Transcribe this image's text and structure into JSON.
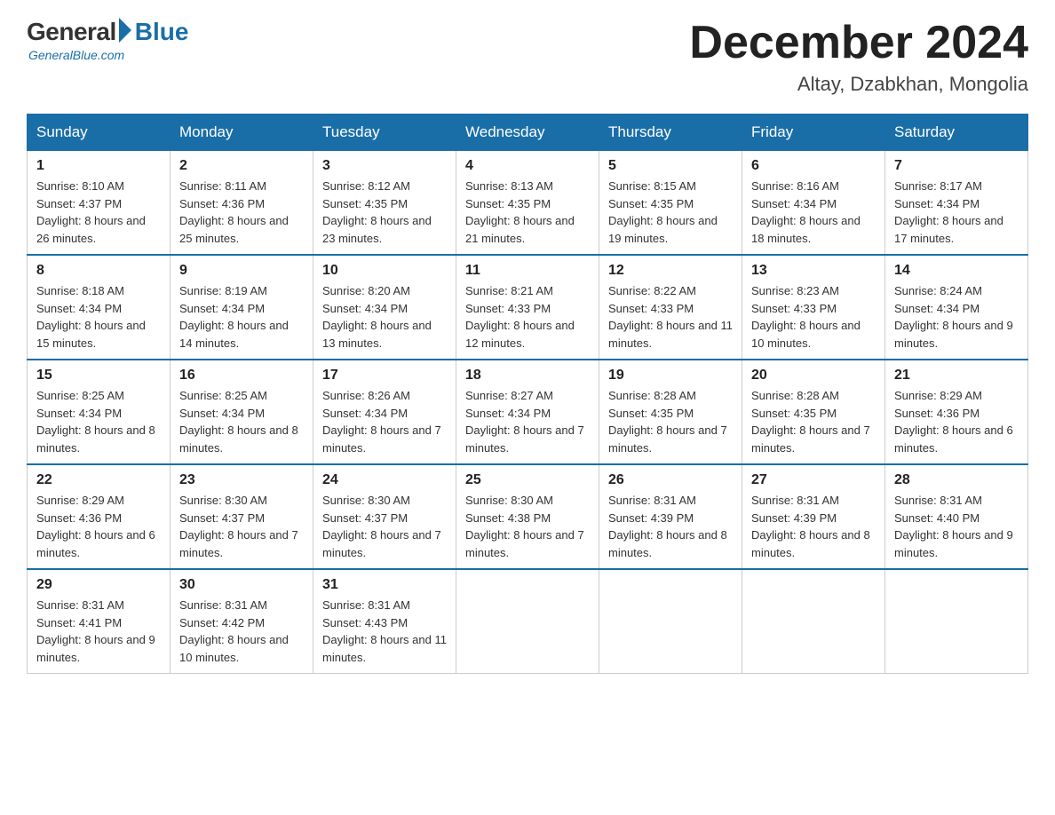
{
  "header": {
    "logo_general": "General",
    "logo_blue": "Blue",
    "logo_tagline": "GeneralBlue.com",
    "month": "December 2024",
    "location": "Altay, Dzabkhan, Mongolia"
  },
  "weekdays": [
    "Sunday",
    "Monday",
    "Tuesday",
    "Wednesday",
    "Thursday",
    "Friday",
    "Saturday"
  ],
  "weeks": [
    [
      {
        "day": "1",
        "sunrise": "8:10 AM",
        "sunset": "4:37 PM",
        "daylight": "8 hours and 26 minutes."
      },
      {
        "day": "2",
        "sunrise": "8:11 AM",
        "sunset": "4:36 PM",
        "daylight": "8 hours and 25 minutes."
      },
      {
        "day": "3",
        "sunrise": "8:12 AM",
        "sunset": "4:35 PM",
        "daylight": "8 hours and 23 minutes."
      },
      {
        "day": "4",
        "sunrise": "8:13 AM",
        "sunset": "4:35 PM",
        "daylight": "8 hours and 21 minutes."
      },
      {
        "day": "5",
        "sunrise": "8:15 AM",
        "sunset": "4:35 PM",
        "daylight": "8 hours and 19 minutes."
      },
      {
        "day": "6",
        "sunrise": "8:16 AM",
        "sunset": "4:34 PM",
        "daylight": "8 hours and 18 minutes."
      },
      {
        "day": "7",
        "sunrise": "8:17 AM",
        "sunset": "4:34 PM",
        "daylight": "8 hours and 17 minutes."
      }
    ],
    [
      {
        "day": "8",
        "sunrise": "8:18 AM",
        "sunset": "4:34 PM",
        "daylight": "8 hours and 15 minutes."
      },
      {
        "day": "9",
        "sunrise": "8:19 AM",
        "sunset": "4:34 PM",
        "daylight": "8 hours and 14 minutes."
      },
      {
        "day": "10",
        "sunrise": "8:20 AM",
        "sunset": "4:34 PM",
        "daylight": "8 hours and 13 minutes."
      },
      {
        "day": "11",
        "sunrise": "8:21 AM",
        "sunset": "4:33 PM",
        "daylight": "8 hours and 12 minutes."
      },
      {
        "day": "12",
        "sunrise": "8:22 AM",
        "sunset": "4:33 PM",
        "daylight": "8 hours and 11 minutes."
      },
      {
        "day": "13",
        "sunrise": "8:23 AM",
        "sunset": "4:33 PM",
        "daylight": "8 hours and 10 minutes."
      },
      {
        "day": "14",
        "sunrise": "8:24 AM",
        "sunset": "4:34 PM",
        "daylight": "8 hours and 9 minutes."
      }
    ],
    [
      {
        "day": "15",
        "sunrise": "8:25 AM",
        "sunset": "4:34 PM",
        "daylight": "8 hours and 8 minutes."
      },
      {
        "day": "16",
        "sunrise": "8:25 AM",
        "sunset": "4:34 PM",
        "daylight": "8 hours and 8 minutes."
      },
      {
        "day": "17",
        "sunrise": "8:26 AM",
        "sunset": "4:34 PM",
        "daylight": "8 hours and 7 minutes."
      },
      {
        "day": "18",
        "sunrise": "8:27 AM",
        "sunset": "4:34 PM",
        "daylight": "8 hours and 7 minutes."
      },
      {
        "day": "19",
        "sunrise": "8:28 AM",
        "sunset": "4:35 PM",
        "daylight": "8 hours and 7 minutes."
      },
      {
        "day": "20",
        "sunrise": "8:28 AM",
        "sunset": "4:35 PM",
        "daylight": "8 hours and 7 minutes."
      },
      {
        "day": "21",
        "sunrise": "8:29 AM",
        "sunset": "4:36 PM",
        "daylight": "8 hours and 6 minutes."
      }
    ],
    [
      {
        "day": "22",
        "sunrise": "8:29 AM",
        "sunset": "4:36 PM",
        "daylight": "8 hours and 6 minutes."
      },
      {
        "day": "23",
        "sunrise": "8:30 AM",
        "sunset": "4:37 PM",
        "daylight": "8 hours and 7 minutes."
      },
      {
        "day": "24",
        "sunrise": "8:30 AM",
        "sunset": "4:37 PM",
        "daylight": "8 hours and 7 minutes."
      },
      {
        "day": "25",
        "sunrise": "8:30 AM",
        "sunset": "4:38 PM",
        "daylight": "8 hours and 7 minutes."
      },
      {
        "day": "26",
        "sunrise": "8:31 AM",
        "sunset": "4:39 PM",
        "daylight": "8 hours and 8 minutes."
      },
      {
        "day": "27",
        "sunrise": "8:31 AM",
        "sunset": "4:39 PM",
        "daylight": "8 hours and 8 minutes."
      },
      {
        "day": "28",
        "sunrise": "8:31 AM",
        "sunset": "4:40 PM",
        "daylight": "8 hours and 9 minutes."
      }
    ],
    [
      {
        "day": "29",
        "sunrise": "8:31 AM",
        "sunset": "4:41 PM",
        "daylight": "8 hours and 9 minutes."
      },
      {
        "day": "30",
        "sunrise": "8:31 AM",
        "sunset": "4:42 PM",
        "daylight": "8 hours and 10 minutes."
      },
      {
        "day": "31",
        "sunrise": "8:31 AM",
        "sunset": "4:43 PM",
        "daylight": "8 hours and 11 minutes."
      },
      null,
      null,
      null,
      null
    ]
  ]
}
